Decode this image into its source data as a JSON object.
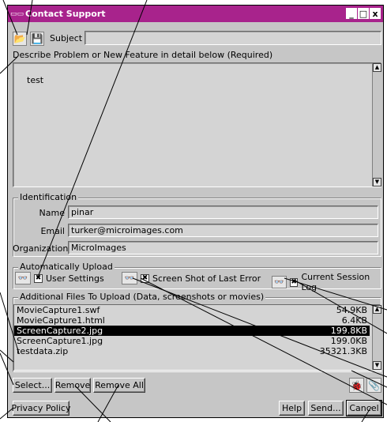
{
  "window": {
    "title": "Contact Support",
    "title_icon": "app-icon"
  },
  "toolbar": {
    "subject_label": "Subject",
    "subject_value": ""
  },
  "description": {
    "label": "Describe Problem or New Feature in detail below (Required)",
    "text": "test"
  },
  "identification": {
    "group_label": "Identification",
    "name_label": "Name",
    "name_value": "pinar",
    "email_label": "Email",
    "email_value": "turker@microimages.com",
    "org_label": "Organization",
    "org_value": "MicroImages"
  },
  "upload": {
    "group_label": "Automatically Upload",
    "options": [
      {
        "label": "User Settings",
        "checked": true
      },
      {
        "label": "Screen Shot of Last Error",
        "checked": true
      },
      {
        "label": "Current Session Log",
        "checked": true
      }
    ]
  },
  "files": {
    "group_label": "Additional Files To Upload (Data, screenshots or movies)",
    "rows": [
      {
        "name": "MovieCapture1.swf",
        "size": "54.9KB",
        "selected": false
      },
      {
        "name": "MovieCapture1.html",
        "size": "6.4KB",
        "selected": false
      },
      {
        "name": "ScreenCapture2.jpg",
        "size": "199.8KB",
        "selected": true
      },
      {
        "name": "ScreenCapture1.jpg",
        "size": "199.0KB",
        "selected": false
      },
      {
        "name": "testdata.zip",
        "size": "35321.3KB",
        "selected": false
      }
    ]
  },
  "buttons": {
    "select": "Select...",
    "remove": "Remove",
    "remove_all": "Remove All",
    "privacy": "Privacy Policy",
    "help": "Help",
    "send": "Send...",
    "cancel": "Cancel"
  },
  "colors": {
    "titlebar": "#a8238c",
    "dialog_bg": "#c6c6c6",
    "selection": "#000000"
  }
}
